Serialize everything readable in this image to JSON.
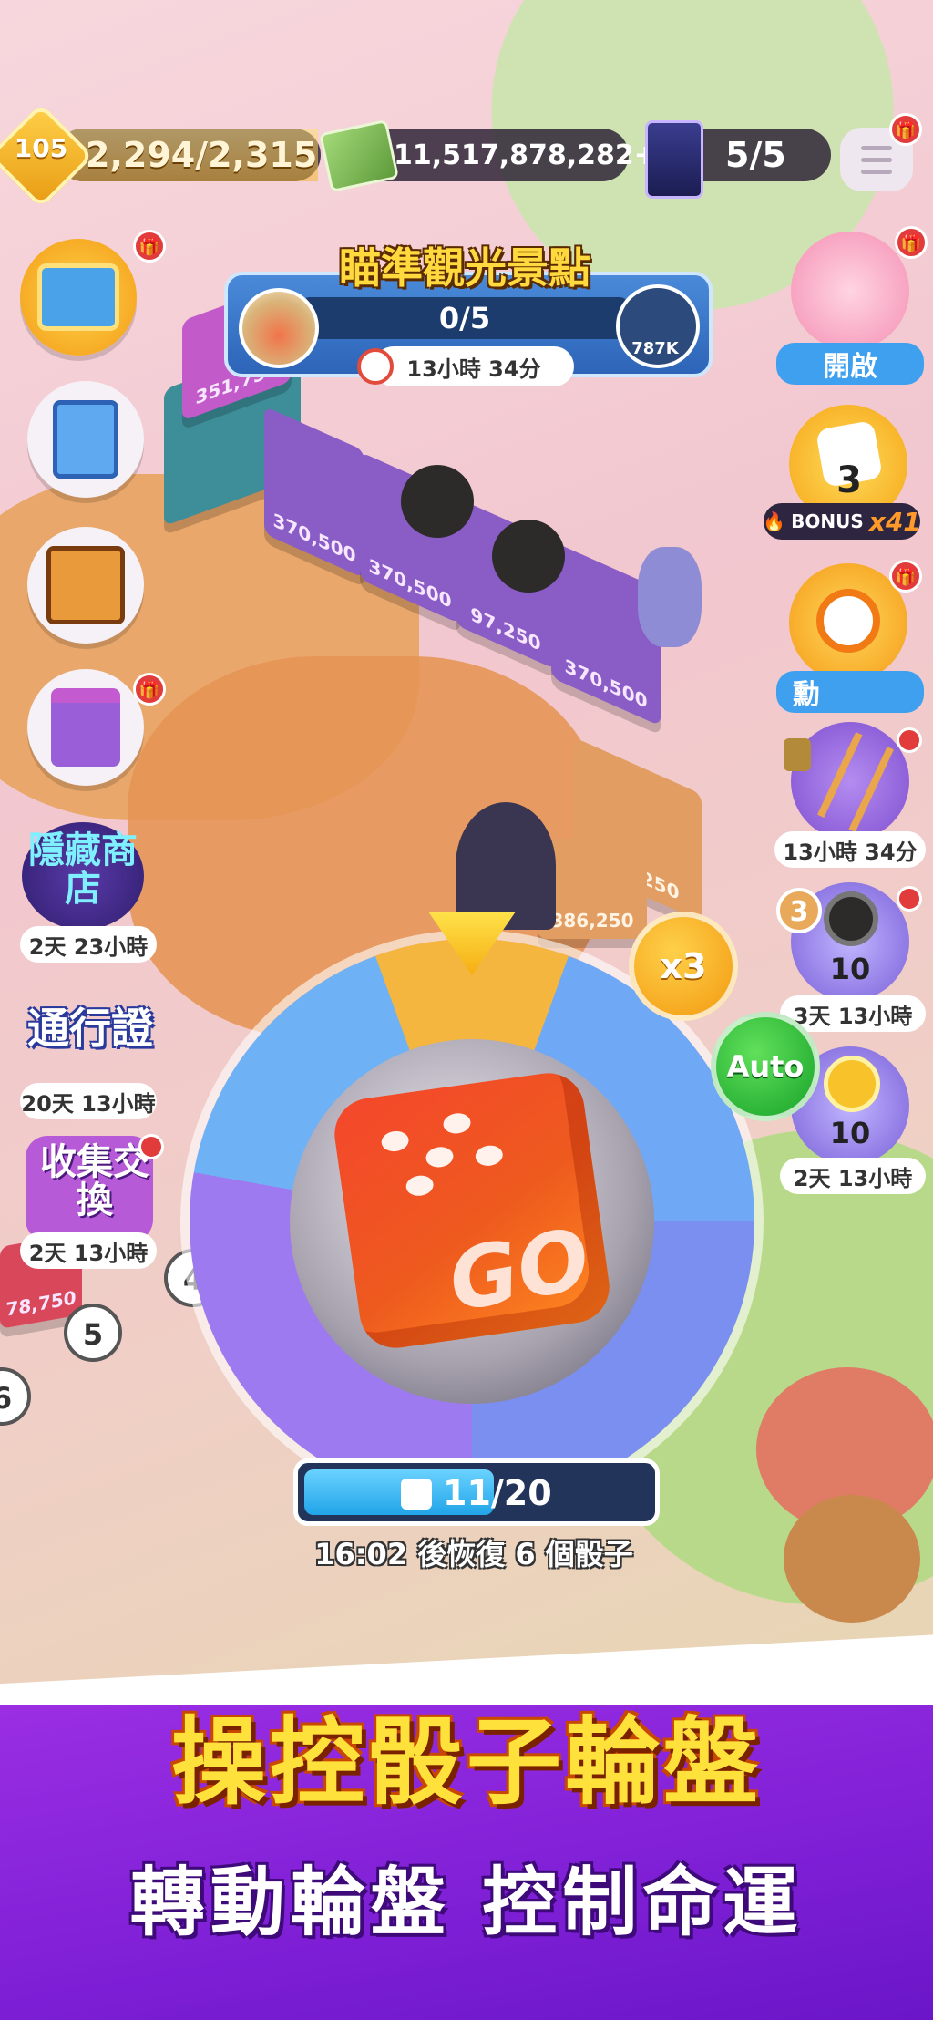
{
  "hud": {
    "level": "105",
    "xp": "2,294/2,315",
    "xp_fraction": 0.99,
    "cash": "11,517,878,282+",
    "cards": "5/5"
  },
  "mission": {
    "title": "瞄準觀光景點",
    "progress": "0/5",
    "reward": "787K",
    "timer": "13小時 34分"
  },
  "left_menu": {
    "hidden_shop": {
      "label": "隱藏商店",
      "timer": "2天 23小時"
    },
    "pass": {
      "label": "通行證",
      "timer": "20天 13小時"
    },
    "collect_exchange": {
      "label": "收集交換",
      "timer": "2天 13小時"
    }
  },
  "right_menu": {
    "open_event": {
      "label": "開啟"
    },
    "bonus_dice": {
      "count": "3",
      "bonus_label": "BONUS",
      "multiplier": "x41"
    },
    "alarm_event": {
      "label": "勳"
    },
    "ladder_event": {
      "timer": "13小時 34分"
    },
    "tire_event": {
      "badge": "3",
      "count": "10",
      "timer": "3天 13小時"
    },
    "star_event": {
      "count": "10",
      "timer": "2天 13小時"
    }
  },
  "board": {
    "tiles": [
      "370,500",
      "370,500",
      "97,250",
      "370,500",
      "386,250",
      "386,250",
      "78,750",
      "351,750"
    ],
    "space_numbers": [
      "5",
      "6",
      "4"
    ]
  },
  "wheel": {
    "multiplier_button": "x3",
    "auto_button": "Auto",
    "dice_face": "GO",
    "dice_count": "11/20",
    "dice_fraction": 0.55,
    "recover_text": "16:02 後恢復 6 個骰子"
  },
  "promo": {
    "headline": "操控骰子輪盤",
    "subline": "轉動輪盤 控制命運"
  },
  "colors": {
    "footer_purple": "#8a27dd",
    "headline_yellow": "#ffe13c",
    "auto_green": "#17a32a",
    "x3_orange": "#f29a10"
  }
}
